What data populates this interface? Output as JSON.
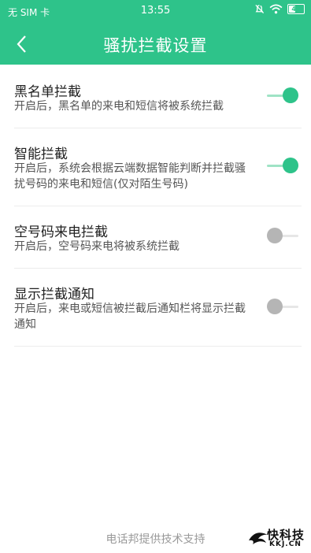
{
  "status": {
    "carrier": "无 SIM 卡",
    "time": "13:55",
    "battery": "40"
  },
  "header": {
    "title": "骚扰拦截设置"
  },
  "settings": [
    {
      "title": "黑名单拦截",
      "desc": "开启后，黑名单的来电和短信将被系统拦截",
      "enabled": true
    },
    {
      "title": "智能拦截",
      "desc": "开启后，系统会根据云端数据智能判断并拦截骚扰号码的来电和短信(仅对陌生号码)",
      "enabled": true
    },
    {
      "title": "空号码来电拦截",
      "desc": "开启后，空号码来电将被系统拦截",
      "enabled": false
    },
    {
      "title": "显示拦截通知",
      "desc": "开启后，来电或短信被拦截后通知栏将显示拦截通知",
      "enabled": false
    }
  ],
  "footer": {
    "text": "电话邦提供技术支持"
  },
  "watermark": {
    "name": "快科技",
    "url": "KKJ.CN"
  },
  "colors": {
    "accent": "#2ec38a",
    "accent_light": "#9fe3c5",
    "off_knob": "#b5b5b5"
  }
}
